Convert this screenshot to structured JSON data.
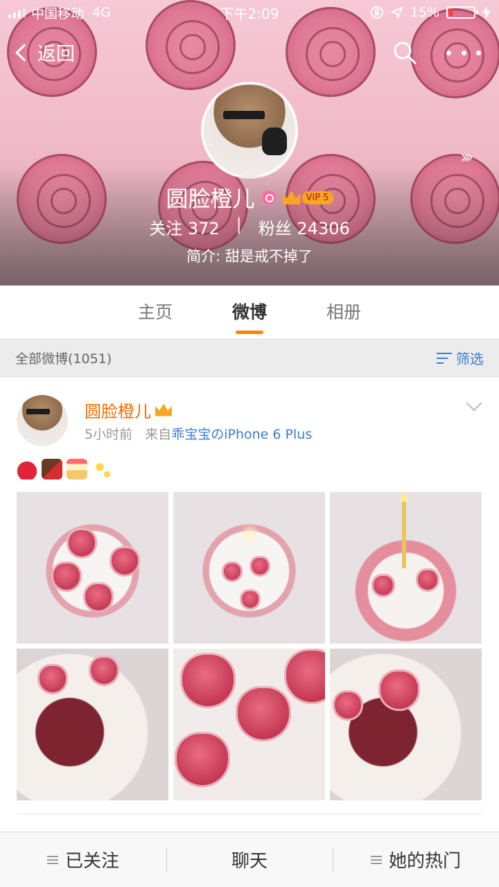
{
  "status_bar": {
    "carrier": "中国移动",
    "network": "4G",
    "time": "下午2:09",
    "battery_percent": "15%",
    "battery_level": 0.15
  },
  "nav": {
    "back_label": "返回"
  },
  "profile": {
    "name": "圆脸橙儿",
    "vip_level": "VIP 5",
    "following_label": "关注",
    "following_count": "372",
    "stats_separator": "|",
    "followers_label": "粉丝",
    "followers_count": "24306",
    "bio": "简介: 甜是戒不掉了"
  },
  "tabs": [
    {
      "label": "主页",
      "active": false
    },
    {
      "label": "微博",
      "active": true
    },
    {
      "label": "相册",
      "active": false
    }
  ],
  "filter_bar": {
    "count_label": "全部微博(1051)",
    "filter_label": "筛选"
  },
  "post": {
    "author": "圆脸橙儿",
    "time": "5小时前",
    "source_prefix": "来自",
    "source": "乖宝宝のiPhone 6 Plus",
    "emojis": [
      "strawberry-icon",
      "chocolate-icon",
      "cake-icon",
      "sparkles-icon"
    ],
    "photo_count": 6
  },
  "bottom_bar": {
    "follow_label": "已关注",
    "chat_label": "聊天",
    "hot_label": "她的热门"
  },
  "colors": {
    "accent_orange": "#ff8200",
    "link_blue": "#3d7cc9",
    "author_orange": "#f56b00",
    "vip_gold": "#f5a623"
  }
}
